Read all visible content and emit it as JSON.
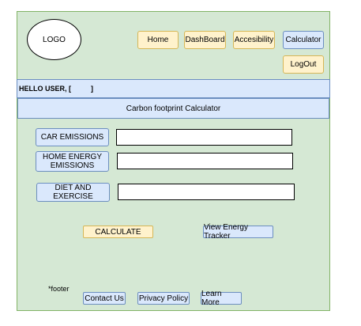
{
  "header": {
    "logo_label": "LOGO",
    "nav": {
      "home": "Home",
      "dashboard": "DashBoard",
      "accessibility": "Accesibility",
      "calculator": "Calculator",
      "logout": "LogOut"
    }
  },
  "greeting": "HELLO USER, [          ]",
  "page_title": "Carbon footprint Calculator",
  "form": {
    "car": {
      "label": "CAR EMISSIONS",
      "value": ""
    },
    "home_energy": {
      "label": "HOME ENERGY EMISSIONS",
      "value": ""
    },
    "diet": {
      "label": "DIET AND EXERCISE",
      "value": ""
    }
  },
  "actions": {
    "calculate": "CALCULATE",
    "energy_tracker": "View Energy Tracker"
  },
  "footer": {
    "note": "*footer",
    "contact": "Contact Us",
    "privacy": "Privacy Policy",
    "learn": "Learn More"
  },
  "colors": {
    "frame_bg": "#d5e8d4",
    "frame_border": "#82b366",
    "yellow_fill": "#fff2cc",
    "yellow_border": "#d6b656",
    "blue_fill": "#dae8fc",
    "blue_border": "#6c8ebf"
  }
}
